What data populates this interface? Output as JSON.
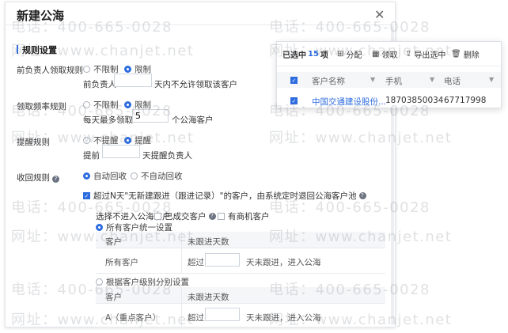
{
  "dialog": {
    "title": "新建公海",
    "close_label": "✕",
    "section_title": "规则设置"
  },
  "rules": {
    "leader": {
      "label": "前负责人领取规则",
      "opt_unlimited": "不限制",
      "opt_limited": "限制",
      "selected": "limited",
      "prefix": "前负责人",
      "value": "",
      "suffix": "天内不允许领取该客户"
    },
    "frequency": {
      "label": "领取频率规则",
      "opt_unlimited": "不限制",
      "opt_limited": "限制",
      "selected": "limited",
      "prefix": "每天最多领取",
      "value": "5",
      "suffix": "个公海客户"
    },
    "reminder": {
      "label": "提醒规则",
      "opt_no": "不提醒",
      "opt_yes": "提醒",
      "selected": "yes",
      "prefix": "提前",
      "value": "",
      "suffix": "天提醒负责人"
    },
    "recall": {
      "label": "收回规则",
      "help_icon": "question-icon",
      "opt_auto": "自动回收",
      "opt_manual": "不自动回收",
      "selected": "auto",
      "checkbox_text": "超过N天\"无新建跟进（跟进记录）\"的客户，由系统定时退回公海客户池",
      "checkbox_checked": true
    },
    "exclude": {
      "label": "选择不进入公海客户",
      "opt_deal": "已成交客户",
      "opt_opportunity": "有商机客户"
    },
    "unified": {
      "label": "所有客户统一设置",
      "selected": true,
      "col_customer": "客户",
      "col_days": "未跟进天数",
      "row_customer": "所有客户",
      "row_prefix": "超过",
      "row_value": "",
      "row_suffix": "天未跟进，进入公海"
    },
    "by_level": {
      "label": "根据客户级别分别设置",
      "selected": false,
      "col_customer": "客户",
      "col_days": "未跟进天数",
      "row_customer": "A（重点客户）",
      "row_prefix": "超过",
      "row_value": "",
      "row_suffix": "天未跟进，进入公海"
    }
  },
  "selection_popup": {
    "selected_prefix": "已选中",
    "selected_count": "15",
    "selected_suffix": "项",
    "actions": [
      {
        "label": "分配",
        "icon": "sitemap-icon"
      },
      {
        "label": "领取",
        "icon": "table-icon"
      },
      {
        "label": "导出选中",
        "icon": "export-icon"
      },
      {
        "label": "删除",
        "icon": "trash-icon"
      }
    ],
    "columns": [
      "客户名称",
      "手机",
      "电话"
    ],
    "rows": [
      {
        "name": "中国交通建设股份...",
        "mobile": "18703850034",
        "phone": "67717998",
        "checked": true
      }
    ]
  },
  "watermark": {
    "phone": "电话：400-665-0028",
    "site": "网址：www.chanjet.net"
  },
  "colors": {
    "accent": "#2d6cdf",
    "link": "#2d6cdf"
  }
}
